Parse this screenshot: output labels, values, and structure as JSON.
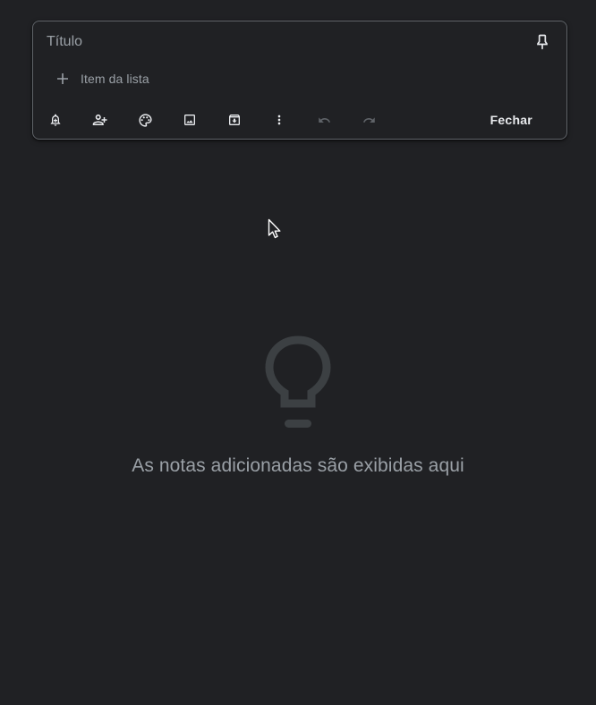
{
  "note_editor": {
    "title_placeholder": "Título",
    "title_value": "",
    "list_item_placeholder": "Item da lista",
    "close_label": "Fechar",
    "toolbar_icons": [
      "add-alert-icon",
      "add-collaborator-icon",
      "palette-icon",
      "image-icon",
      "archive-icon",
      "more-vert-icon",
      "undo-icon",
      "redo-icon"
    ]
  },
  "empty_state": {
    "icon": "lightbulb-icon",
    "message": "As notas adicionadas são exibidas aqui"
  },
  "colors": {
    "background": "#202124",
    "border": "#5f6368",
    "text_primary": "#e8eaed",
    "text_secondary": "#9aa0a6",
    "icon_disabled": "#5f6368",
    "empty_icon": "#3c4043"
  }
}
